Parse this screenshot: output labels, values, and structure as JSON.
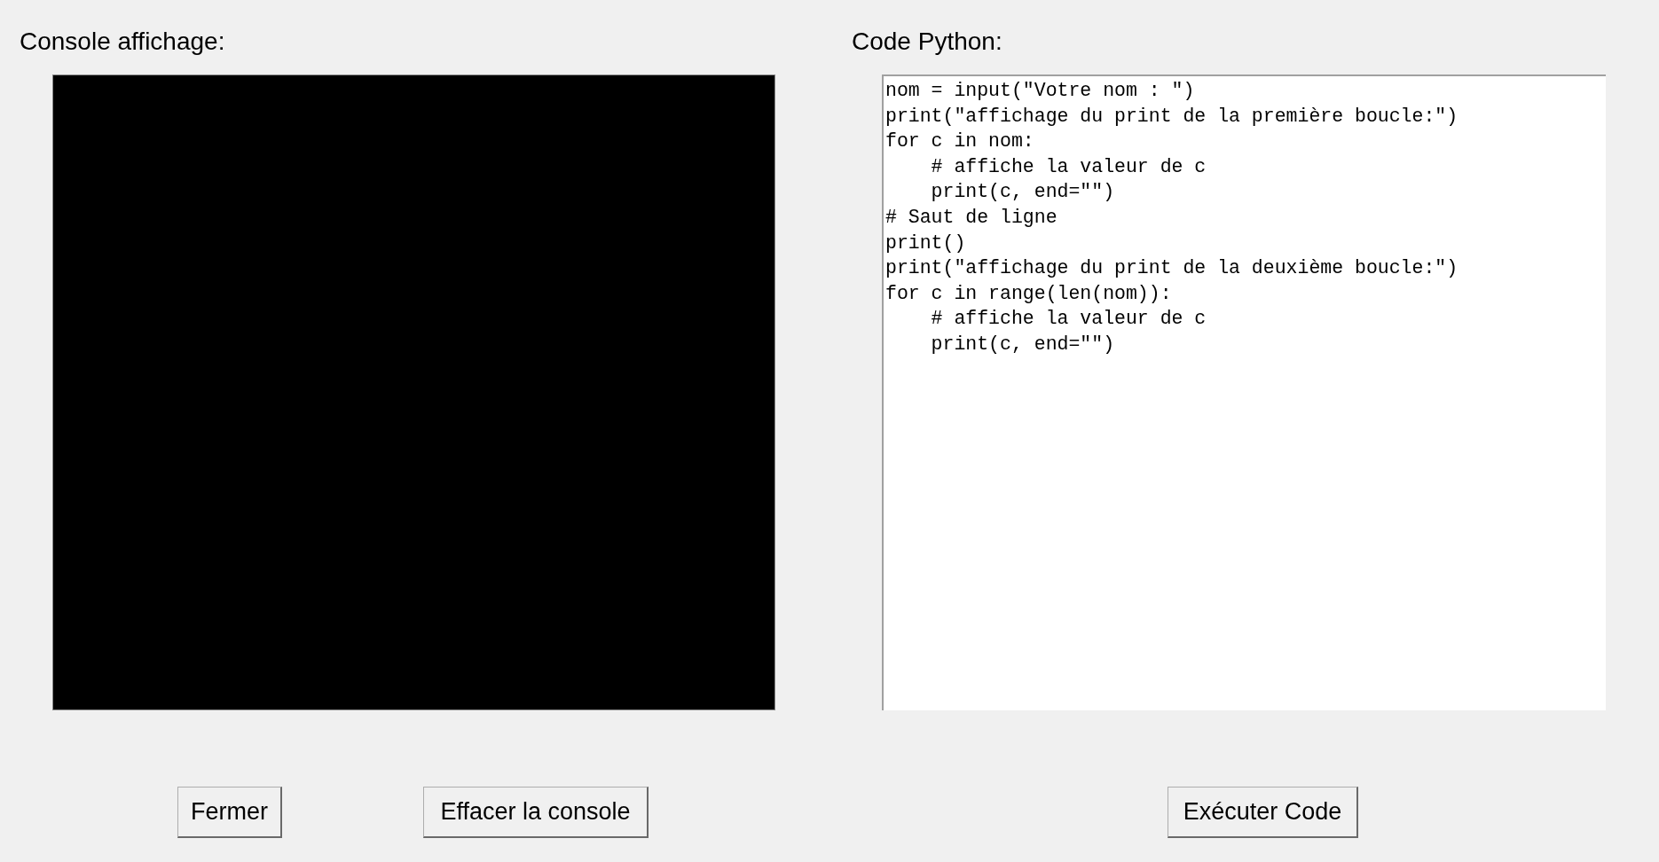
{
  "console_panel": {
    "title": "Console affichage:"
  },
  "code_panel": {
    "title": "Code Python:",
    "lines": [
      "nom = input(\"Votre nom : \")",
      "print(\"affichage du print de la première boucle:\")",
      "for c in nom:",
      "    # affiche la valeur de c",
      "    print(c, end=\"\")",
      "# Saut de ligne",
      "print()",
      "print(\"affichage du print de la deuxième boucle:\")",
      "for c in range(len(nom)):",
      "    # affiche la valeur de c",
      "    print(c, end=\"\")"
    ]
  },
  "buttons": [
    "Fermer",
    "Effacer la console",
    "Exécuter Code"
  ]
}
